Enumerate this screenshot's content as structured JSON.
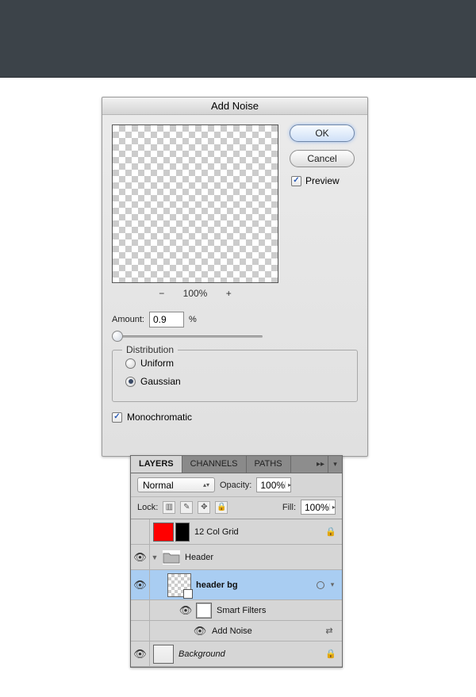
{
  "dialog": {
    "title": "Add Noise",
    "buttons": {
      "ok": "OK",
      "cancel": "Cancel"
    },
    "preview_label": "Preview",
    "zoom": {
      "minus": "−",
      "level": "100%",
      "plus": "+"
    },
    "amount": {
      "label": "Amount:",
      "value": "0.9",
      "unit": "%"
    },
    "distribution": {
      "legend": "Distribution",
      "options": [
        "Uniform",
        "Gaussian"
      ],
      "selected": "Gaussian"
    },
    "monochromatic_label": "Monochromatic",
    "monochromatic_checked": true,
    "preview_checked": true
  },
  "panel": {
    "tabs": [
      "LAYERS",
      "CHANNELS",
      "PATHS"
    ],
    "blend_mode": "Normal",
    "opacity_label": "Opacity:",
    "opacity_value": "100%",
    "lock_label": "Lock:",
    "fill_label": "Fill:",
    "fill_value": "100%",
    "layers": [
      {
        "name": "12 Col Grid",
        "visible": false,
        "locked": true
      },
      {
        "name": "Header",
        "visible": true,
        "type": "group",
        "expanded": true
      },
      {
        "name": "header bg",
        "visible": true,
        "type": "smart-object",
        "selected": true
      },
      {
        "name": "Smart Filters",
        "visible": true
      },
      {
        "name": "Add Noise",
        "visible": true,
        "type": "filter"
      },
      {
        "name": "Background",
        "visible": true,
        "locked": true
      }
    ]
  }
}
